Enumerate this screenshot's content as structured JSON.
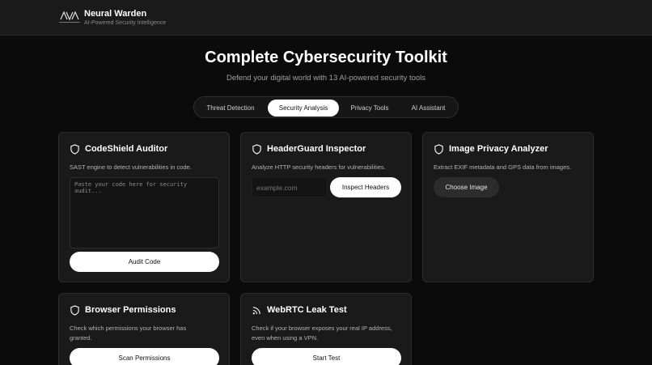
{
  "header": {
    "brand_name": "Neural Warden",
    "brand_tagline": "AI-Powered Security Intelligence",
    "logo_caption": "NEURAL WARDEN"
  },
  "hero": {
    "title": "Complete Cybersecurity Toolkit",
    "subtitle": "Defend your digital world with 13 AI-powered security tools"
  },
  "tabs": [
    {
      "label": "Threat Detection",
      "active": false
    },
    {
      "label": "Security Analysis",
      "active": true
    },
    {
      "label": "Privacy Tools",
      "active": false
    },
    {
      "label": "AI Assistant",
      "active": false
    }
  ],
  "cards": {
    "codeshield": {
      "icon": "shield-icon",
      "title": "CodeShield Auditor",
      "description": "SAST engine to detect vulnerabilities in code.",
      "placeholder": "Paste your code here for security audit...",
      "button": "Audit Code"
    },
    "headerguard": {
      "icon": "shield-icon",
      "title": "HeaderGuard Inspector",
      "description": "Analyze HTTP security headers for vulnerabilities.",
      "placeholder": "example.com",
      "button": "Inspect Headers"
    },
    "imageprivacy": {
      "icon": "shield-icon",
      "title": "Image Privacy Analyzer",
      "description": "Extract EXIF metadata and GPS data from images.",
      "button": "Choose Image"
    },
    "browserperms": {
      "icon": "shield-icon",
      "title": "Browser Permissions",
      "description": "Check which permissions your browser has granted.",
      "button": "Scan Permissions"
    },
    "webrtc": {
      "icon": "rss-icon",
      "title": "WebRTC Leak Test",
      "description": "Check if your browser exposes your real IP address, even when using a VPN.",
      "button": "Start Test"
    }
  },
  "colors": {
    "background": "#0b0b0b",
    "card": "#1a1a1a",
    "accent": "#ffffff"
  }
}
